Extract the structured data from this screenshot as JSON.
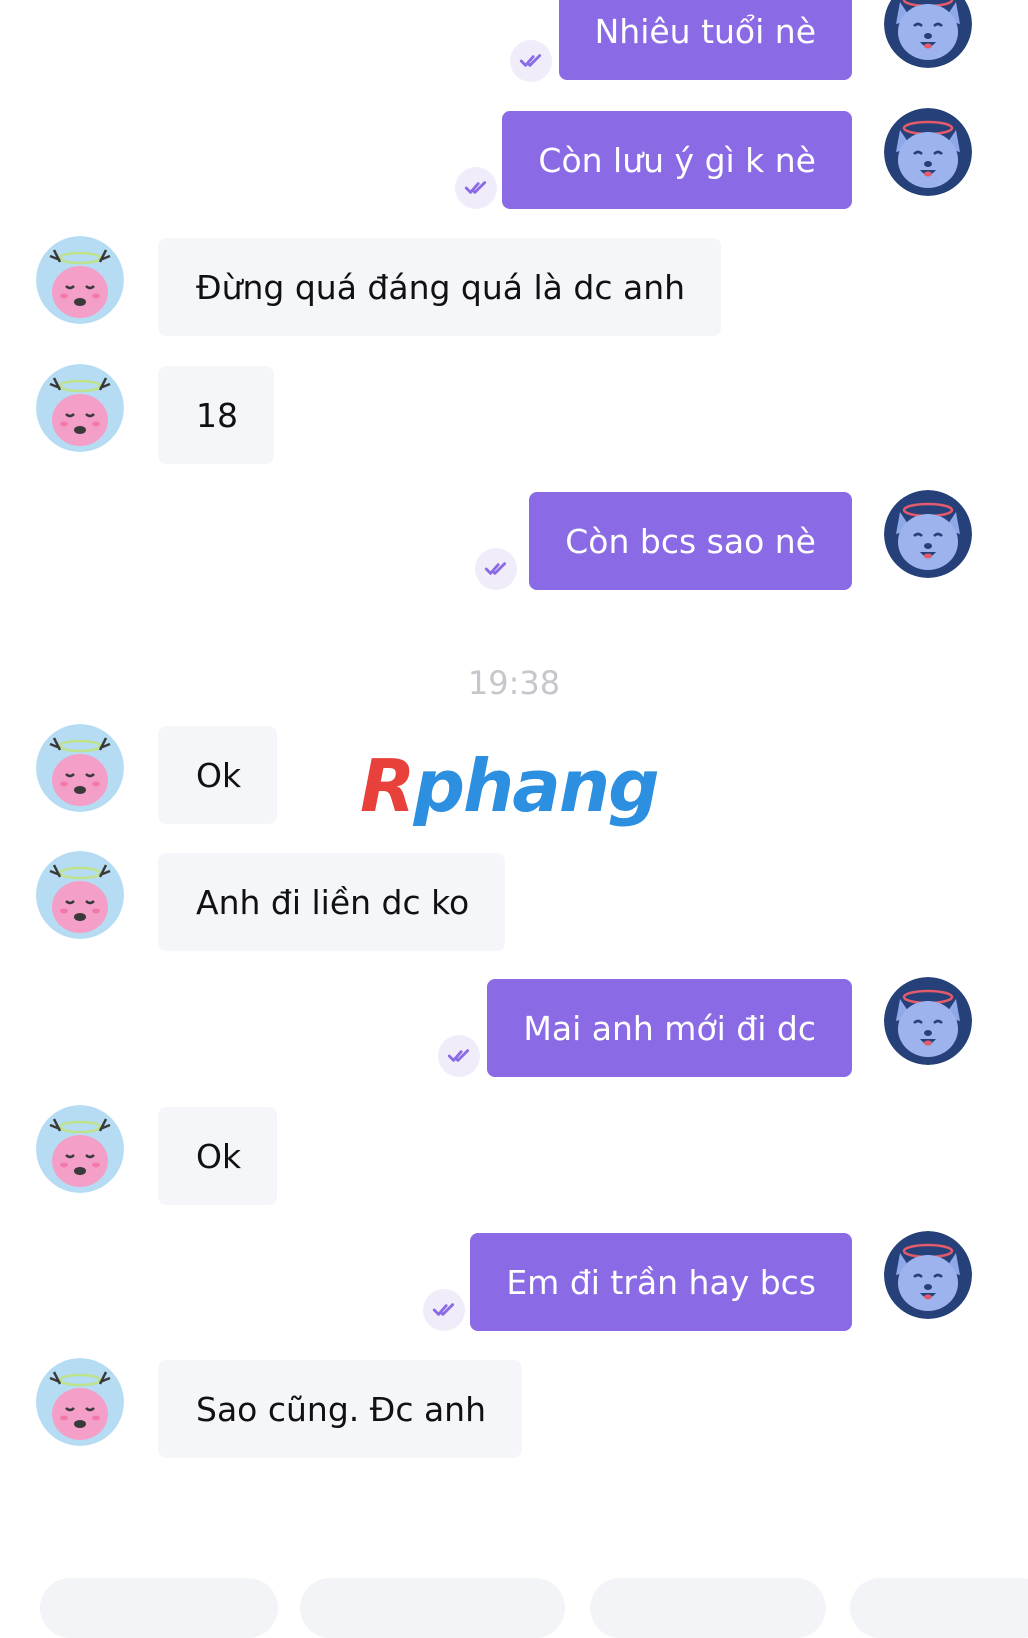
{
  "conversation": {
    "timestamp": "19:38",
    "messages": [
      {
        "sender": "me",
        "text": "Nhiêu tuổi nè"
      },
      {
        "sender": "me",
        "text": "Còn lưu ý gì k nè"
      },
      {
        "sender": "them",
        "text": "Đừng quá đáng quá là dc anh"
      },
      {
        "sender": "them",
        "text": "18"
      },
      {
        "sender": "me",
        "text": "Còn bcs sao nè"
      },
      {
        "sender": "them",
        "text": "Ok"
      },
      {
        "sender": "them",
        "text": "Anh đi liền dc ko"
      },
      {
        "sender": "me",
        "text": "Mai anh mới đi dc"
      },
      {
        "sender": "them",
        "text": "Ok"
      },
      {
        "sender": "me",
        "text": "Em đi trần hay bcs"
      },
      {
        "sender": "them",
        "text": "Sao cũng. Đc anh"
      }
    ]
  },
  "watermark": {
    "part1": "R",
    "part2": "phang"
  },
  "colors": {
    "my_bubble": "#8a6ae5",
    "their_bubble": "#f5f6fa",
    "my_avatar_bg": "#26407a",
    "their_avatar_bg": "#b6dcf3",
    "read_tick": "#8a6ae5"
  },
  "icons": {
    "my_avatar": "wolf-face-avatar-icon",
    "their_avatar": "pink-deer-face-avatar-icon",
    "read_receipt": "double-check-icon"
  }
}
